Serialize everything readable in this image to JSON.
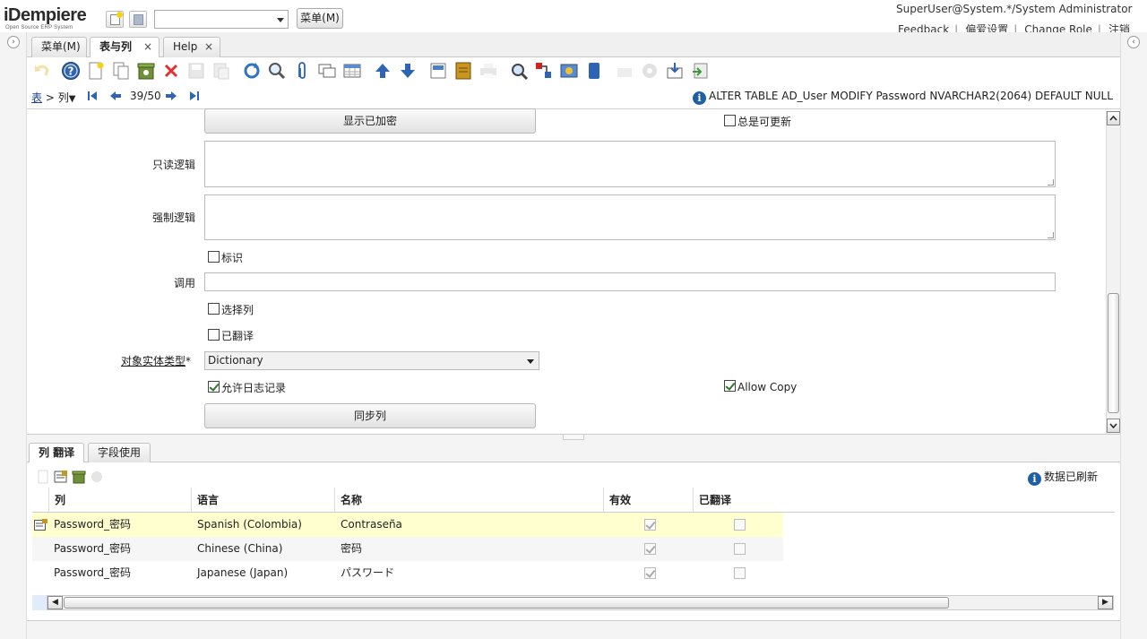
{
  "header": {
    "logo_main": "iDempiere",
    "logo_sub": "Open Source ERP System",
    "menu_button": "菜单(M)",
    "user": "SuperUser@System.*/System Administrator",
    "links": [
      "Feedback",
      "偏爱设置",
      "Change Role",
      "注销"
    ]
  },
  "tabs": [
    {
      "label": "菜单(M)",
      "active": false,
      "closable": false
    },
    {
      "label": "表与列",
      "active": true,
      "closable": true
    },
    {
      "label": "Help",
      "active": false,
      "closable": true
    }
  ],
  "toolbar_icons": [
    "undo-icon",
    "help-icon",
    "new-record-icon",
    "copy-record-icon",
    "delete-selected-icon",
    "delete-icon",
    "save-icon",
    "save-create-icon",
    "refresh-icon",
    "find-icon",
    "attachment-icon",
    "chat-icon",
    "grid-toggle-icon",
    "parent-record-icon",
    "detail-record-icon",
    "report-icon",
    "archive-icon",
    "print-icon",
    "zoom-across-icon",
    "active-workflows-icon",
    "requests-icon",
    "product-info-icon",
    "lock-icon",
    "process-icon",
    "export-icon",
    "import-icon",
    "customize-icon"
  ],
  "navbar": {
    "crumb_parent": "表",
    "crumb_sep": ">",
    "crumb_current": "列",
    "record": "39/50",
    "status": "ALTER TABLE AD_User MODIFY Password NVARCHAR2(2064) DEFAULT NULL"
  },
  "form": {
    "show_encrypted_button": "显示已加密",
    "always_updatable": {
      "label": "总是可更新",
      "checked": false
    },
    "readonly_logic_label": "只读逻辑",
    "mandatory_logic_label": "强制逻辑",
    "identifier": {
      "label": "标识",
      "checked": false
    },
    "callout_label": "调用",
    "callout_value": "",
    "selection_column": {
      "label": "选择列",
      "checked": false
    },
    "translated": {
      "label": "已翻译",
      "checked": false
    },
    "entity_type_label": "对象实体类型",
    "entity_type_required": "*",
    "entity_type_value": "Dictionary",
    "allow_logging": {
      "label": "允许日志记录",
      "checked": true
    },
    "allow_copy": {
      "label": "Allow Copy",
      "checked": true
    },
    "sync_button": "同步列"
  },
  "detail": {
    "tabs": [
      {
        "label": "列 翻译",
        "active": true
      },
      {
        "label": "字段使用",
        "active": false
      }
    ],
    "refresh_status": "数据已刷新",
    "columns": [
      "列",
      "语言",
      "名称",
      "有效",
      "已翻译"
    ],
    "rows": [
      {
        "column": "Password_密码",
        "language": "Spanish (Colombia)",
        "name": "Contraseña",
        "active": true,
        "translated": false,
        "selected": true
      },
      {
        "column": "Password_密码",
        "language": "Chinese (China)",
        "name": "密码",
        "active": true,
        "translated": false,
        "selected": false
      },
      {
        "column": "Password_密码",
        "language": "Japanese (Japan)",
        "name": "パスワード",
        "active": true,
        "translated": false,
        "selected": false
      }
    ]
  }
}
